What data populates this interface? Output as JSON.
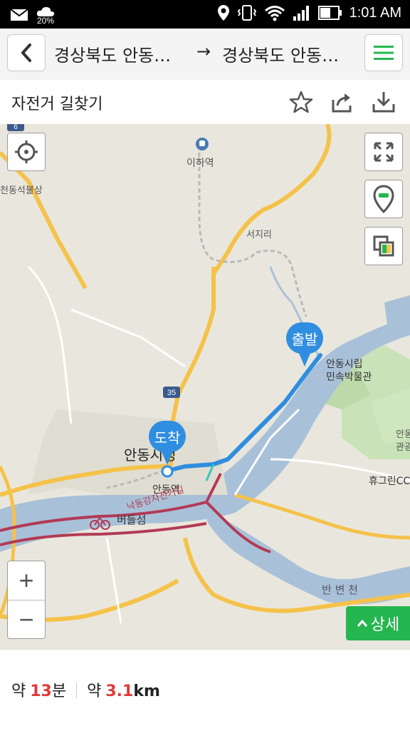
{
  "status_bar": {
    "icons_left": [
      "mail-icon",
      "weather-cloud-icon"
    ],
    "weather_percent": "20%",
    "icons_right": [
      "location-icon",
      "vibrate-icon",
      "wifi-icon",
      "signal-icon",
      "battery-icon"
    ],
    "time": "1:01 AM"
  },
  "header": {
    "from": "경상북도 안동…",
    "arrow": "→",
    "to": "경상북도 안동…"
  },
  "title_bar": {
    "title": "자전거 길찾기",
    "icons": [
      "star-icon",
      "share-icon",
      "download-icon"
    ]
  },
  "map": {
    "labels": {
      "station_top": "이하역",
      "seoji": "서지리",
      "cheondong": "천동석불상",
      "museum_1": "안동시립",
      "museum_2": "민속박물관",
      "city": "안동시청",
      "andong_station": "안동역",
      "beodeulseom": "버들섬",
      "bike_road": "낙동강자전거길",
      "banbyeon": "반 변 천",
      "andong_right": "안동",
      "gwan": "관광",
      "hugreen": "휴그린CC",
      "route_35": "35",
      "route_6": "6"
    },
    "start_pin": "출발",
    "end_pin": "도착",
    "route_color": "#2f8ee0",
    "river_color": "#a9c1d8",
    "road_color": "#f5c24a",
    "bike_path_color": "#b23a56"
  },
  "controls": {
    "zoom_in": "+",
    "zoom_out": "−",
    "detail_label": "상세",
    "detail_color": "#25b64f"
  },
  "summary": {
    "time_prefix": "약",
    "time_value": "13",
    "time_unit": "분",
    "dist_prefix": "약",
    "dist_value": "3.1",
    "dist_unit": "km"
  }
}
